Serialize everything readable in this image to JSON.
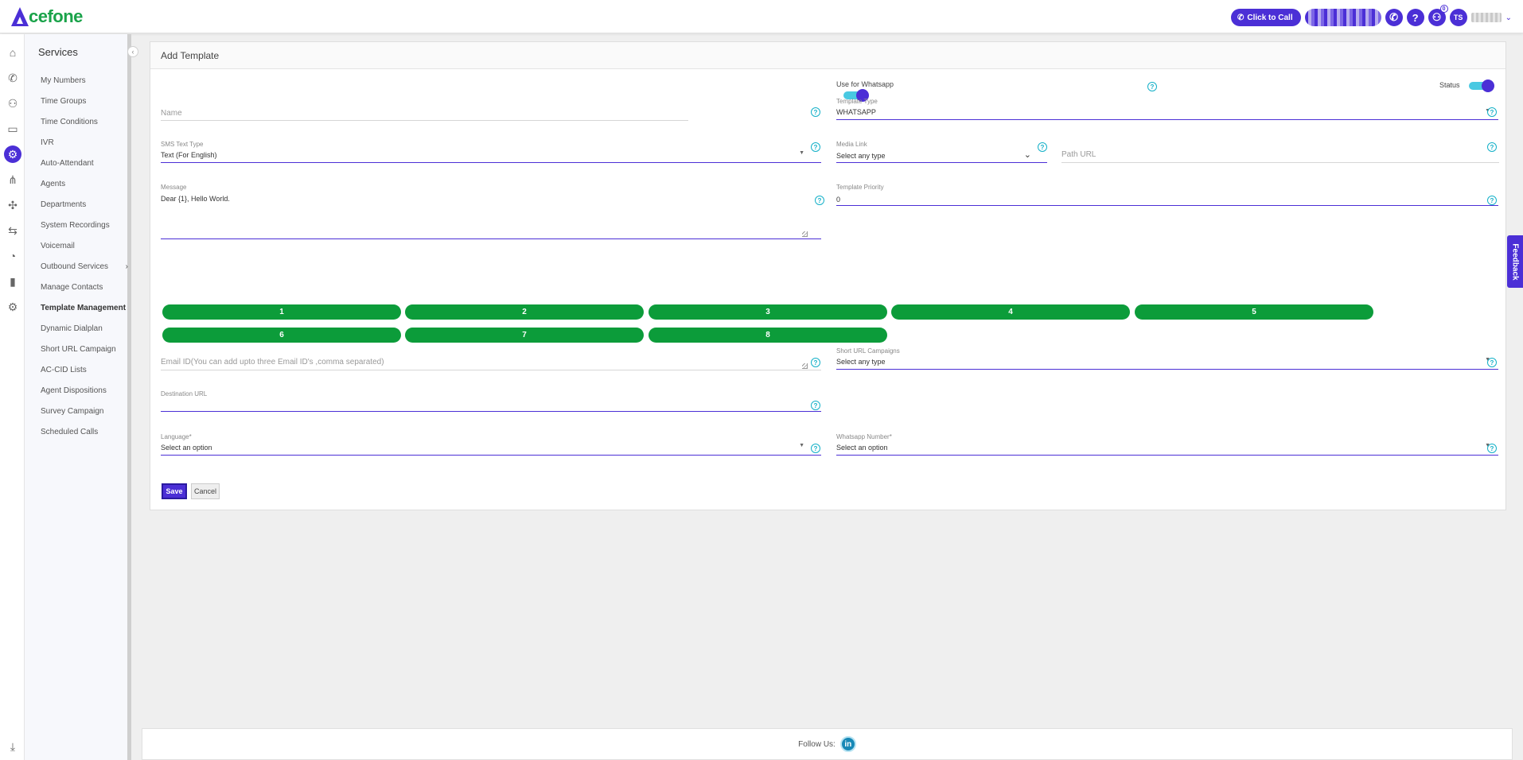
{
  "app": {
    "logo_text": "cefone",
    "click_to_call": "Click to Call",
    "user_initials": "TS",
    "notification_count": "0",
    "help_label": "?"
  },
  "services": {
    "title": "Services",
    "items": [
      {
        "label": "My Numbers"
      },
      {
        "label": "Time Groups"
      },
      {
        "label": "Time Conditions"
      },
      {
        "label": "IVR"
      },
      {
        "label": "Auto-Attendant"
      },
      {
        "label": "Agents"
      },
      {
        "label": "Departments"
      },
      {
        "label": "System Recordings"
      },
      {
        "label": "Voicemail"
      },
      {
        "label": "Outbound Services",
        "submenu": "›"
      },
      {
        "label": "Manage Contacts"
      },
      {
        "label": "Template Management",
        "active": true
      },
      {
        "label": "Dynamic Dialplan"
      },
      {
        "label": "Short URL Campaign"
      },
      {
        "label": "AC-CID Lists"
      },
      {
        "label": "Agent Dispositions"
      },
      {
        "label": "Survey Campaign"
      },
      {
        "label": "Scheduled Calls"
      }
    ]
  },
  "form": {
    "header": "Add Template",
    "use_for_whatsapp": "Use for Whatsapp",
    "status": "Status",
    "name_placeholder": "Name",
    "template_type_label": "Template Type",
    "template_type_value": "WHATSAPP",
    "sms_text_type_label": "SMS Text Type",
    "sms_text_type_value": "Text (For English)",
    "media_link_label": "Media Link",
    "media_link_value": "Select any type",
    "path_url_placeholder": "Path URL",
    "message_label": "Message",
    "message_value": "Dear {1}, Hello World.",
    "template_priority_label": "Template Priority",
    "template_priority_value": "0",
    "variable_buttons": [
      "1",
      "2",
      "3",
      "4",
      "5",
      "6",
      "7",
      "8"
    ],
    "email_placeholder": "Email ID(You can add upto three Email ID's ,comma separated)",
    "short_url_label": "Short URL Campaigns",
    "short_url_value": "Select any type",
    "destination_url_label": "Destination URL",
    "language_label": "Language*",
    "language_value": "Select an option",
    "whatsapp_number_label": "Whatsapp Number*",
    "whatsapp_number_value": "Select an option",
    "save": "Save",
    "cancel": "Cancel"
  },
  "footer": {
    "follow_us": "Follow Us:",
    "linkedin": "in"
  },
  "feedback": "Feedback",
  "colors": {
    "accent": "#4b2fd6",
    "brand_green": "#1aa34a",
    "pill_green": "#0c9c3a",
    "help_cyan": "#13b0c8"
  }
}
